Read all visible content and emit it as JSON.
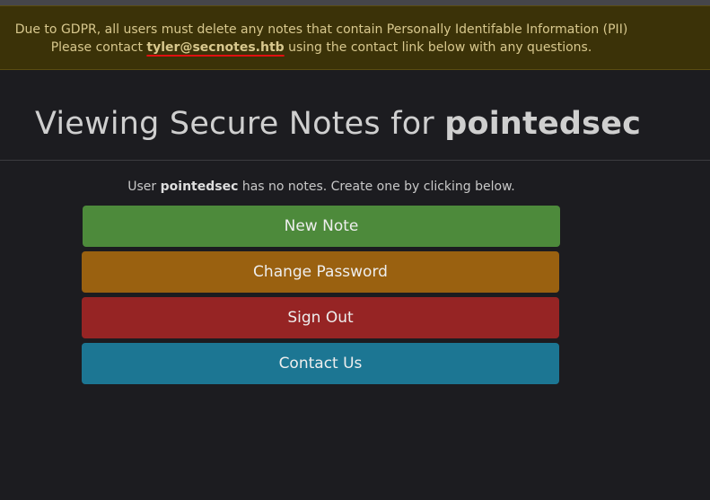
{
  "banner": {
    "line1": "Due to GDPR, all users must delete any notes that contain Personally Identifable Information (PII)",
    "line2_prefix": "Please contact ",
    "email": "tyler@secnotes.htb",
    "line2_suffix": " using the contact link below with any questions."
  },
  "header": {
    "title_prefix": "Viewing Secure Notes for ",
    "username": "pointedsec"
  },
  "notes_info": {
    "prefix": "User ",
    "username": "pointedsec",
    "suffix": " has no notes. Create one by clicking below."
  },
  "actions": {
    "new_note": "New Note",
    "change_password": "Change Password",
    "sign_out": "Sign Out",
    "contact_us": "Contact Us"
  },
  "colors": {
    "background": "#1c1c20",
    "banner": "#3b3208",
    "new_note": "#4d8a3b",
    "change_password": "#9a6110",
    "sign_out": "#962424",
    "contact_us": "#1c7693"
  }
}
